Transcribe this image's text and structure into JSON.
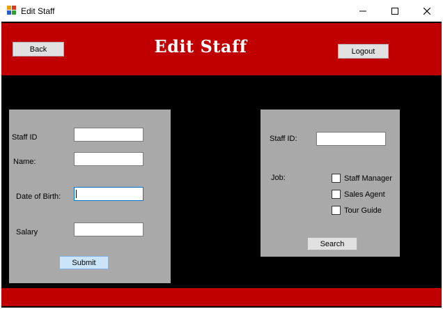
{
  "window": {
    "title": "Edit Staff"
  },
  "header": {
    "back_label": "Back",
    "title": "Edit Staff",
    "logout_label": "Logout"
  },
  "edit_panel": {
    "staff_id_label": "Staff ID",
    "name_label": "Name:",
    "dob_label": "Date of Birth:",
    "salary_label": "Salary",
    "staff_id_value": "",
    "name_value": "",
    "dob_value": "",
    "salary_value": "",
    "submit_label": "Submit"
  },
  "search_panel": {
    "staff_id_label": "Staff ID:",
    "staff_id_value": "",
    "job_label": "Job:",
    "jobs": [
      {
        "label": "Staff Manager",
        "checked": false
      },
      {
        "label": "Sales Agent",
        "checked": false
      },
      {
        "label": "Tour Guide",
        "checked": false
      }
    ],
    "search_label": "Search"
  },
  "colors": {
    "header": "#c00000",
    "background": "#000000",
    "panel": "#a9a9a9"
  }
}
